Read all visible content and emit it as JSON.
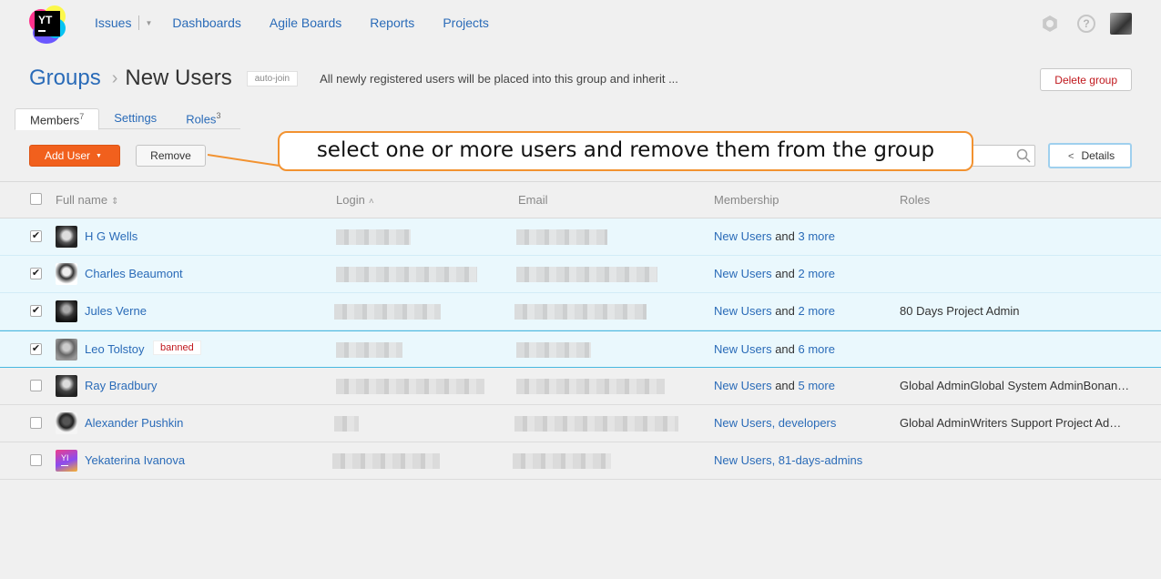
{
  "nav": {
    "logo_text": "YT",
    "issues": "Issues",
    "items": [
      "Dashboards",
      "Agile Boards",
      "Reports",
      "Projects"
    ]
  },
  "header": {
    "breadcrumb": "Groups",
    "title": "New Users",
    "badge": "auto-join",
    "description": "All newly registered users will be placed into this group and inherit ...",
    "delete_label": "Delete group"
  },
  "tabs": [
    {
      "label": "Members",
      "count": "7"
    },
    {
      "label": "Settings",
      "count": ""
    },
    {
      "label": "Roles",
      "count": "3"
    }
  ],
  "toolbar": {
    "add_user_label": "Add User",
    "remove_label": "Remove",
    "details_label": "Details"
  },
  "callout": "select one or more users and remove them from the group",
  "table": {
    "headers": {
      "full_name": "Full name",
      "login": "Login",
      "email": "Email",
      "membership": "Membership",
      "roles": "Roles"
    },
    "rows": [
      {
        "name": "H G Wells",
        "checked": true,
        "banned": "",
        "membership_group": "New Users",
        "membership_and": " and ",
        "membership_more": "3 more",
        "roles": ""
      },
      {
        "name": "Charles Beaumont",
        "checked": true,
        "banned": "",
        "membership_group": "New Users",
        "membership_and": " and ",
        "membership_more": "2 more",
        "roles": ""
      },
      {
        "name": "Jules Verne",
        "checked": true,
        "banned": "",
        "membership_group": "New Users",
        "membership_and": " and ",
        "membership_more": "2 more",
        "roles": "80 Days Project Admin"
      },
      {
        "name": "Leo Tolstoy",
        "checked": true,
        "banned": "banned",
        "membership_group": "New Users",
        "membership_and": " and ",
        "membership_more": "6 more",
        "roles": ""
      },
      {
        "name": "Ray Bradbury",
        "checked": false,
        "banned": "",
        "membership_group": "New Users",
        "membership_and": " and ",
        "membership_more": "5 more",
        "roles": "Global AdminGlobal System AdminBonan…"
      },
      {
        "name": "Alexander Pushkin",
        "checked": false,
        "banned": "",
        "membership_group": "New Users, developers",
        "membership_and": "",
        "membership_more": "",
        "roles": "Global AdminWriters Support Project Ad…"
      },
      {
        "name": "Yekaterina Ivanova",
        "checked": false,
        "banned": "",
        "membership_group": "New Users, 81-days-admins",
        "membership_and": "",
        "membership_more": "",
        "roles": "",
        "avatar_initials": "YI"
      }
    ]
  },
  "colors": {
    "accent": "#2a6bb8",
    "primary_button": "#f1601d",
    "callout_border": "#f29230",
    "selected_row": "#eaf8fd",
    "danger": "#c0171c"
  }
}
